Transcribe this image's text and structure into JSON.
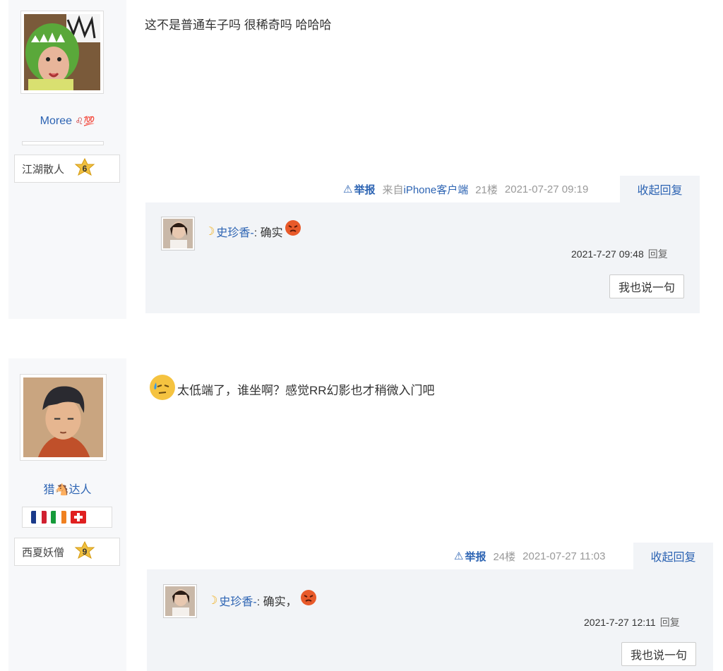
{
  "posts": [
    {
      "username": "Moree",
      "username_suffix": "♌💯",
      "level_title": "江湖散人",
      "level_num": "6",
      "content": "这不是普通车子吗 很稀奇吗 哈哈哈",
      "report_label": "举报",
      "source_prefix": "来自",
      "source_client": "iPhone客户端",
      "floor": "21楼",
      "time": "2021-07-27 09:19",
      "collapse_label": "收起回复",
      "reply": {
        "user": "史珍香-",
        "text": ": 确实",
        "time": "2021-7-27 09:48",
        "reply_label": "回复"
      },
      "say_label": "我也说一句"
    },
    {
      "username": "猎🐴达人",
      "level_title": "西夏妖僧",
      "level_num": "9",
      "content": "太低端了，谁坐啊？感觉RR幻影也才稍微入门吧",
      "report_label": "举报",
      "floor": "24楼",
      "time": "2021-07-27 11:03",
      "collapse_label": "收起回复",
      "reply": {
        "user": "史珍香-",
        "text": ": 确实，",
        "time": "2021-7-27 12:11",
        "reply_label": "回复"
      },
      "say_label": "我也说一句"
    }
  ],
  "colors": {
    "link": "#2d64b3",
    "sidebar_bg": "#f7f8fa",
    "reply_bg": "#f2f4f7"
  }
}
